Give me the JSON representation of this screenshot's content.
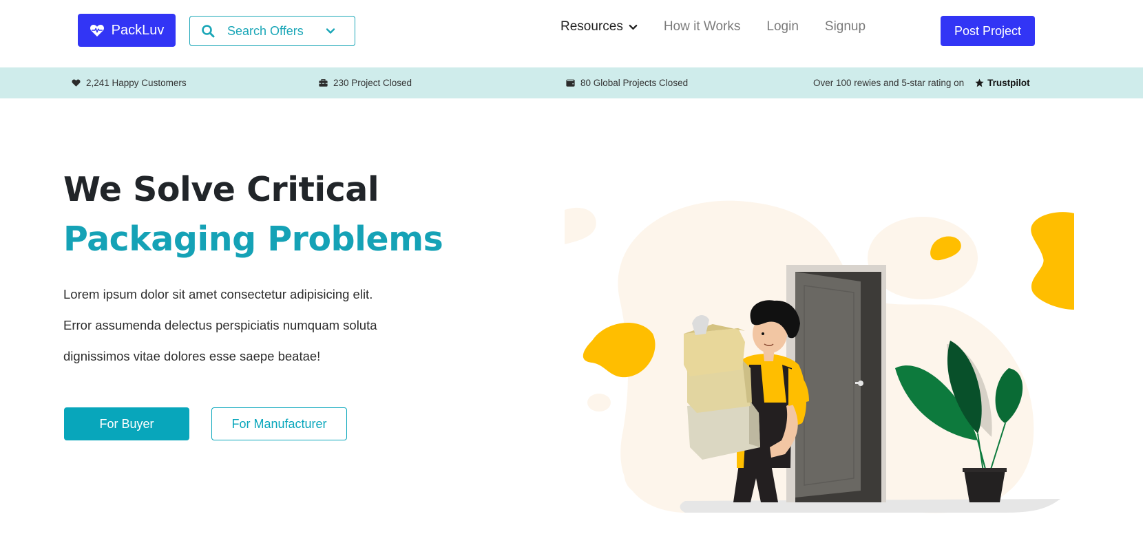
{
  "brand": {
    "name": "PackLuv",
    "icon": "heart-pulse-icon"
  },
  "search": {
    "label": "Search Offers",
    "icon": "search-icon",
    "caret": "chevron-down-icon"
  },
  "nav": {
    "resources": "Resources",
    "how_it_works": "How it Works",
    "login": "Login",
    "signup": "Signup",
    "post_project": "Post Project"
  },
  "stats": {
    "customers": {
      "icon": "heart-icon",
      "text": "2,241 Happy Customers"
    },
    "closed": {
      "icon": "toolbox-icon",
      "text": "230 Project Closed"
    },
    "global": {
      "icon": "wallet-icon",
      "text": "80 Global Projects Closed"
    },
    "rating": {
      "text": "Over 100 rewies and 5-star rating on",
      "icon": "star-icon",
      "brand": "Trustpilot"
    }
  },
  "hero": {
    "title_line1": "We Solve Critical",
    "title_line2": "Packaging Problems",
    "text_line1": "Lorem ipsum dolor sit amet consectetur adipisicing elit.",
    "text_line2": "Error assumenda delectus perspiciatis numquam soluta",
    "text_line3": "dignissimos vitae dolores esse saepe beatae!",
    "buyer_button": "For Buyer",
    "manufacturer_button": "For Manufacturer"
  },
  "colors": {
    "primary_blue": "#3235f5",
    "teal": "#15a2b6",
    "strip_bg": "#cfeceb",
    "accent_yellow": "#ffbe00"
  }
}
